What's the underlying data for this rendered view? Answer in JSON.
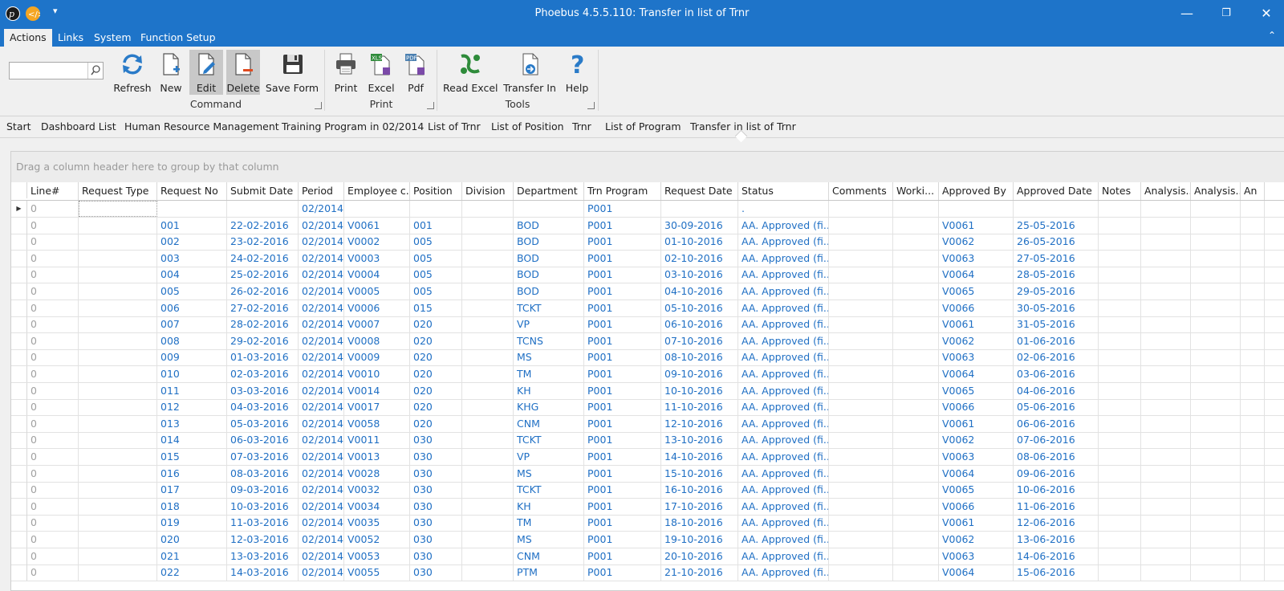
{
  "window": {
    "title": "Phoebus 4.5.5.110: Transfer in list of Trnr",
    "minimize": "—",
    "restore": "❐",
    "close": "✕",
    "quick_access": "▾"
  },
  "menu": {
    "tabs": [
      "Actions",
      "Links",
      "System",
      "Function Setup"
    ],
    "active": "Actions",
    "collapse": "⌃"
  },
  "ribbon": {
    "search": {
      "value": "",
      "placeholder": ""
    },
    "buttons": {
      "refresh": "Refresh",
      "new": "New",
      "edit": "Edit",
      "delete": "Delete",
      "save_form": "Save Form",
      "print": "Print",
      "excel": "Excel",
      "pdf": "Pdf",
      "read_excel": "Read Excel",
      "transfer_in": "Transfer In",
      "help": "Help"
    },
    "groups": {
      "command": "Command",
      "print": "Print",
      "tools": "Tools"
    }
  },
  "breadcrumb": [
    "Start",
    "Dashboard List",
    "Human Resource Management",
    "Training Program in 02/2014",
    "List of Trnr",
    "List of Position",
    "Trnr",
    "List of Program",
    "Transfer in list of Trnr"
  ],
  "grid": {
    "group_hint": "Drag a column header here to group by that column",
    "columns": [
      "Line#",
      "Request Type",
      "Request No",
      "Submit Date",
      "Period",
      "Employee c...",
      "Position",
      "Division",
      "Department",
      "Trn Program",
      "Request Date",
      "Status",
      "Comments",
      "Worki...",
      "Approved By",
      "Approved Date",
      "Notes",
      "Analysis...",
      "Analysis...",
      "An"
    ],
    "new_row": {
      "line": "0",
      "period": "02/2014",
      "program": "P001",
      "status": "."
    },
    "rows": [
      [
        "0",
        "",
        "001",
        "22-02-2016",
        "02/2014",
        "V0061",
        "001",
        "",
        "BOD",
        "P001",
        "30-09-2016",
        "AA. Approved (fi...",
        "",
        "",
        "V0061",
        "25-05-2016"
      ],
      [
        "0",
        "",
        "002",
        "23-02-2016",
        "02/2014",
        "V0002",
        "005",
        "",
        "BOD",
        "P001",
        "01-10-2016",
        "AA. Approved (fi...",
        "",
        "",
        "V0062",
        "26-05-2016"
      ],
      [
        "0",
        "",
        "003",
        "24-02-2016",
        "02/2014",
        "V0003",
        "005",
        "",
        "BOD",
        "P001",
        "02-10-2016",
        "AA. Approved (fi...",
        "",
        "",
        "V0063",
        "27-05-2016"
      ],
      [
        "0",
        "",
        "004",
        "25-02-2016",
        "02/2014",
        "V0004",
        "005",
        "",
        "BOD",
        "P001",
        "03-10-2016",
        "AA. Approved (fi...",
        "",
        "",
        "V0064",
        "28-05-2016"
      ],
      [
        "0",
        "",
        "005",
        "26-02-2016",
        "02/2014",
        "V0005",
        "005",
        "",
        "BOD",
        "P001",
        "04-10-2016",
        "AA. Approved (fi...",
        "",
        "",
        "V0065",
        "29-05-2016"
      ],
      [
        "0",
        "",
        "006",
        "27-02-2016",
        "02/2014",
        "V0006",
        "015",
        "",
        "TCKT",
        "P001",
        "05-10-2016",
        "AA. Approved (fi...",
        "",
        "",
        "V0066",
        "30-05-2016"
      ],
      [
        "0",
        "",
        "007",
        "28-02-2016",
        "02/2014",
        "V0007",
        "020",
        "",
        "VP",
        "P001",
        "06-10-2016",
        "AA. Approved (fi...",
        "",
        "",
        "V0061",
        "31-05-2016"
      ],
      [
        "0",
        "",
        "008",
        "29-02-2016",
        "02/2014",
        "V0008",
        "020",
        "",
        "TCNS",
        "P001",
        "07-10-2016",
        "AA. Approved (fi...",
        "",
        "",
        "V0062",
        "01-06-2016"
      ],
      [
        "0",
        "",
        "009",
        "01-03-2016",
        "02/2014",
        "V0009",
        "020",
        "",
        "MS",
        "P001",
        "08-10-2016",
        "AA. Approved (fi...",
        "",
        "",
        "V0063",
        "02-06-2016"
      ],
      [
        "0",
        "",
        "010",
        "02-03-2016",
        "02/2014",
        "V0010",
        "020",
        "",
        "TM",
        "P001",
        "09-10-2016",
        "AA. Approved (fi...",
        "",
        "",
        "V0064",
        "03-06-2016"
      ],
      [
        "0",
        "",
        "011",
        "03-03-2016",
        "02/2014",
        "V0014",
        "020",
        "",
        "KH",
        "P001",
        "10-10-2016",
        "AA. Approved (fi...",
        "",
        "",
        "V0065",
        "04-06-2016"
      ],
      [
        "0",
        "",
        "012",
        "04-03-2016",
        "02/2014",
        "V0017",
        "020",
        "",
        "KHG",
        "P001",
        "11-10-2016",
        "AA. Approved (fi...",
        "",
        "",
        "V0066",
        "05-06-2016"
      ],
      [
        "0",
        "",
        "013",
        "05-03-2016",
        "02/2014",
        "V0058",
        "020",
        "",
        "CNM",
        "P001",
        "12-10-2016",
        "AA. Approved (fi...",
        "",
        "",
        "V0061",
        "06-06-2016"
      ],
      [
        "0",
        "",
        "014",
        "06-03-2016",
        "02/2014",
        "V0011",
        "030",
        "",
        "TCKT",
        "P001",
        "13-10-2016",
        "AA. Approved (fi...",
        "",
        "",
        "V0062",
        "07-06-2016"
      ],
      [
        "0",
        "",
        "015",
        "07-03-2016",
        "02/2014",
        "V0013",
        "030",
        "",
        "VP",
        "P001",
        "14-10-2016",
        "AA. Approved (fi...",
        "",
        "",
        "V0063",
        "08-06-2016"
      ],
      [
        "0",
        "",
        "016",
        "08-03-2016",
        "02/2014",
        "V0028",
        "030",
        "",
        "MS",
        "P001",
        "15-10-2016",
        "AA. Approved (fi...",
        "",
        "",
        "V0064",
        "09-06-2016"
      ],
      [
        "0",
        "",
        "017",
        "09-03-2016",
        "02/2014",
        "V0032",
        "030",
        "",
        "TCKT",
        "P001",
        "16-10-2016",
        "AA. Approved (fi...",
        "",
        "",
        "V0065",
        "10-06-2016"
      ],
      [
        "0",
        "",
        "018",
        "10-03-2016",
        "02/2014",
        "V0034",
        "030",
        "",
        "KH",
        "P001",
        "17-10-2016",
        "AA. Approved (fi...",
        "",
        "",
        "V0066",
        "11-06-2016"
      ],
      [
        "0",
        "",
        "019",
        "11-03-2016",
        "02/2014",
        "V0035",
        "030",
        "",
        "TM",
        "P001",
        "18-10-2016",
        "AA. Approved (fi...",
        "",
        "",
        "V0061",
        "12-06-2016"
      ],
      [
        "0",
        "",
        "020",
        "12-03-2016",
        "02/2014",
        "V0052",
        "030",
        "",
        "MS",
        "P001",
        "19-10-2016",
        "AA. Approved (fi...",
        "",
        "",
        "V0062",
        "13-06-2016"
      ],
      [
        "0",
        "",
        "021",
        "13-03-2016",
        "02/2014",
        "V0053",
        "030",
        "",
        "CNM",
        "P001",
        "20-10-2016",
        "AA. Approved (fi...",
        "",
        "",
        "V0063",
        "14-06-2016"
      ],
      [
        "0",
        "",
        "022",
        "14-03-2016",
        "02/2014",
        "V0055",
        "030",
        "",
        "PTM",
        "P001",
        "21-10-2016",
        "AA. Approved (fi...",
        "",
        "",
        "V0064",
        "15-06-2016"
      ]
    ]
  }
}
